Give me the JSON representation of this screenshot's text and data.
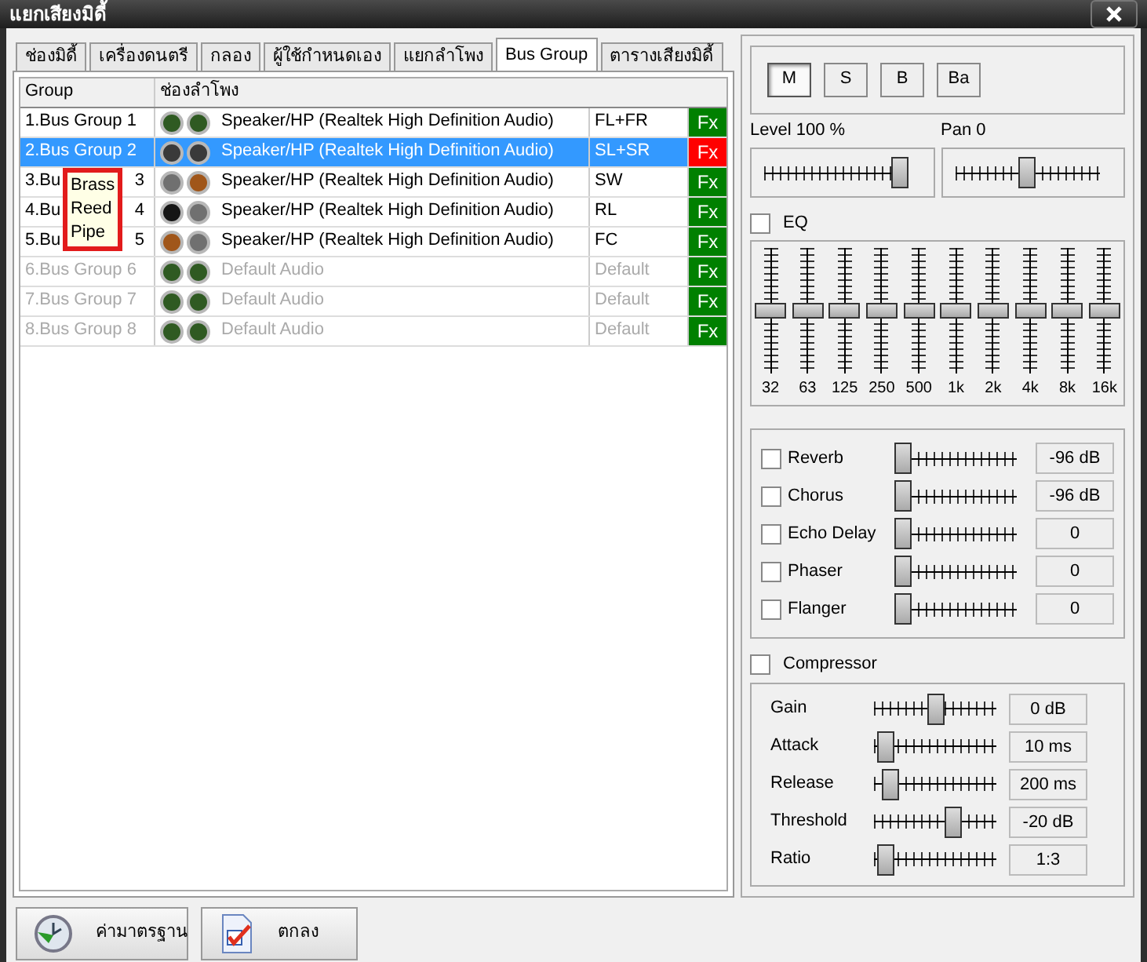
{
  "window": {
    "title": "แยกเสียงมิดี้"
  },
  "tabs": [
    {
      "label": "ช่องมิดี้",
      "selected": false
    },
    {
      "label": "เครื่องดนตรี",
      "selected": false
    },
    {
      "label": "กลอง",
      "selected": false
    },
    {
      "label": "ผู้ใช้กำหนดเอง",
      "selected": false
    },
    {
      "label": "แยกลำโพง",
      "selected": false
    },
    {
      "label": "Bus Group",
      "selected": true
    },
    {
      "label": "ตารางเสียงมิดี้",
      "selected": false
    }
  ],
  "table": {
    "columns": [
      "Group",
      "ช่องลำโพง"
    ],
    "rows": [
      {
        "group": "1.Bus Group 1",
        "jacks": [
          {
            "color": "#2f5a22"
          },
          {
            "color": "#2f5a22"
          }
        ],
        "device": "Speaker/HP (Realtek High Definition Audio)",
        "channel": "FL+FR",
        "fx": {
          "label": "Fx",
          "color": "#008000"
        },
        "selected": false,
        "disabled": false
      },
      {
        "group": "2.Bus Group 2",
        "jacks": [
          {
            "color": "#3a3a3a"
          },
          {
            "color": "#3a3a3a"
          }
        ],
        "device": "Speaker/HP (Realtek High Definition Audio)",
        "channel": "SL+SR",
        "fx": {
          "label": "Fx",
          "color": "#ff0000"
        },
        "selected": true,
        "disabled": false
      },
      {
        "group": "3.Bu",
        "group_tail": "3",
        "jacks": [
          {
            "color": "#707070"
          },
          {
            "color": "#a0561a"
          }
        ],
        "device": "Speaker/HP (Realtek High Definition Audio)",
        "channel": "SW",
        "fx": {
          "label": "Fx",
          "color": "#008000"
        },
        "selected": false,
        "disabled": false
      },
      {
        "group": "4.Bu",
        "group_tail": "4",
        "jacks": [
          {
            "color": "#151515"
          },
          {
            "color": "#707070"
          }
        ],
        "device": "Speaker/HP (Realtek High Definition Audio)",
        "channel": "RL",
        "fx": {
          "label": "Fx",
          "color": "#008000"
        },
        "selected": false,
        "disabled": false
      },
      {
        "group": "5.Bu",
        "group_tail": "5",
        "jacks": [
          {
            "color": "#a0561a"
          },
          {
            "color": "#707070"
          }
        ],
        "device": "Speaker/HP (Realtek High Definition Audio)",
        "channel": "FC",
        "fx": {
          "label": "Fx",
          "color": "#008000"
        },
        "selected": false,
        "disabled": false
      },
      {
        "group": "6.Bus Group 6",
        "jacks": [
          {
            "color": "#2f5a22"
          },
          {
            "color": "#2f5a22"
          }
        ],
        "device": "Default Audio",
        "channel": "Default",
        "fx": {
          "label": "Fx",
          "color": "#008000"
        },
        "selected": false,
        "disabled": true
      },
      {
        "group": "7.Bus Group 7",
        "jacks": [
          {
            "color": "#2f5a22"
          },
          {
            "color": "#2f5a22"
          }
        ],
        "device": "Default Audio",
        "channel": "Default",
        "fx": {
          "label": "Fx",
          "color": "#008000"
        },
        "selected": false,
        "disabled": true
      },
      {
        "group": "8.Bus Group 8",
        "jacks": [
          {
            "color": "#2f5a22"
          },
          {
            "color": "#2f5a22"
          }
        ],
        "device": "Default Audio",
        "channel": "Default",
        "fx": {
          "label": "Fx",
          "color": "#008000"
        },
        "selected": false,
        "disabled": true
      }
    ]
  },
  "popup_list": [
    "Brass",
    "Reed",
    "Pipe"
  ],
  "mode_buttons": [
    {
      "label": "M",
      "selected": true
    },
    {
      "label": "S",
      "selected": false
    },
    {
      "label": "B",
      "selected": false
    },
    {
      "label": "Ba",
      "selected": false
    }
  ],
  "level": {
    "label": "Level 100 %",
    "level": 1.0
  },
  "pan": {
    "label": "Pan 0",
    "level": 0.5
  },
  "eq": {
    "label": "EQ",
    "checked": false,
    "bands": [
      {
        "label": "32",
        "level": 0.5
      },
      {
        "label": "63",
        "level": 0.5
      },
      {
        "label": "125",
        "level": 0.5
      },
      {
        "label": "250",
        "level": 0.5
      },
      {
        "label": "500",
        "level": 0.5
      },
      {
        "label": "1k",
        "level": 0.5
      },
      {
        "label": "2k",
        "level": 0.5
      },
      {
        "label": "4k",
        "level": 0.5
      },
      {
        "label": "8k",
        "level": 0.5
      },
      {
        "label": "16k",
        "level": 0.5
      }
    ]
  },
  "effects": [
    {
      "label": "Reverb",
      "checked": false,
      "level": 0,
      "reading": "-96 dB"
    },
    {
      "label": "Chorus",
      "checked": false,
      "level": 0,
      "reading": "-96 dB"
    },
    {
      "label": "Echo Delay",
      "checked": false,
      "level": 0,
      "reading": "0"
    },
    {
      "label": "Phaser",
      "checked": false,
      "level": 0,
      "reading": "0"
    },
    {
      "label": "Flanger",
      "checked": false,
      "level": 0,
      "reading": "0"
    }
  ],
  "compressor": {
    "label": "Compressor",
    "checked": false,
    "params": [
      {
        "label": "Gain",
        "level": 0.5,
        "reading": "0 dB"
      },
      {
        "label": "Attack",
        "level": 0.03,
        "reading": "10 ms"
      },
      {
        "label": "Release",
        "level": 0.07,
        "reading": "200 ms"
      },
      {
        "label": "Threshold",
        "level": 0.67,
        "reading": "-20 dB"
      },
      {
        "label": "Ratio",
        "level": 0.03,
        "reading": "1:3"
      }
    ]
  },
  "footer_buttons": [
    {
      "kind": "reset",
      "label": "ค่ามาตรฐาน"
    },
    {
      "kind": "ok",
      "label": "ตกลง"
    }
  ]
}
